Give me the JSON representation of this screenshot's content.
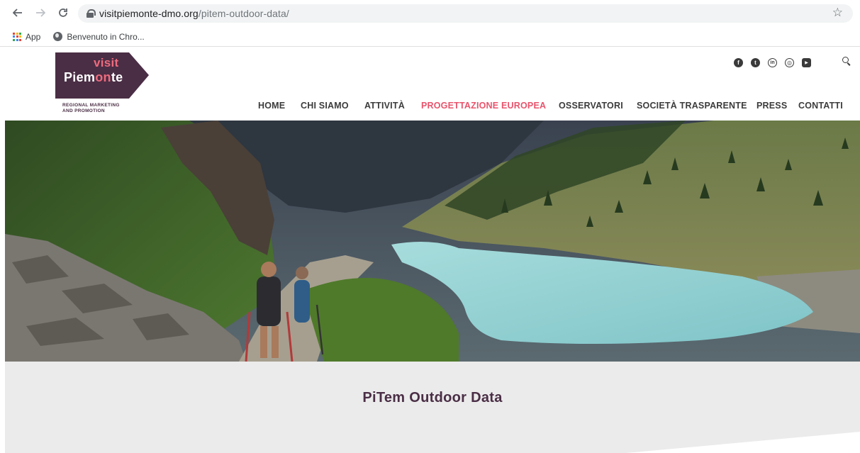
{
  "browser": {
    "url_domain": "visitpiemonte-dmo.org",
    "url_path": "/pitem-outdoor-data/",
    "bookmarks": [
      {
        "label": "App",
        "icon": "apps-grid-icon"
      },
      {
        "label": "Benvenuto in Chro...",
        "icon": "globe-icon"
      }
    ]
  },
  "site": {
    "logo": {
      "line1": "visit",
      "line2_a": "Piem",
      "line2_b": "on",
      "line2_c": "te",
      "tagline_1": "REGIONAL MARKETING",
      "tagline_2": "AND PROMOTION"
    },
    "social": [
      {
        "name": "facebook-icon",
        "glyph": "f"
      },
      {
        "name": "twitter-icon",
        "glyph": "t"
      },
      {
        "name": "linkedin-icon",
        "glyph": "in"
      },
      {
        "name": "instagram-icon",
        "glyph": "◎"
      },
      {
        "name": "youtube-icon",
        "glyph": "▶"
      }
    ],
    "nav": [
      {
        "label": "HOME",
        "active": false
      },
      {
        "label": "CHI SIAMO",
        "active": false
      },
      {
        "label": "ATTIVITÀ",
        "active": false
      },
      {
        "label": "PROGETTAZIONE EUROPEA",
        "active": true
      },
      {
        "label": "OSSERVATORI",
        "active": false
      },
      {
        "label": "SOCIETÀ TRASPARENTE",
        "active": false
      },
      {
        "label": "PRESS",
        "active": false
      },
      {
        "label": "CONTATTI",
        "active": false
      }
    ],
    "accent_color": "#e8546c",
    "brand_color": "#4a2e45"
  },
  "page": {
    "title": "PiTem Outdoor Data"
  }
}
